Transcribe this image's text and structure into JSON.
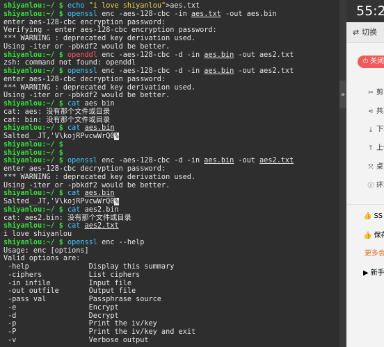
{
  "terminal": {
    "lines": [
      [
        {
          "t": "shiyanlou:~/ $ ",
          "k": "u"
        },
        {
          "t": "echo ",
          "k": "c"
        },
        {
          "t": "\"i love shiyanlou\"",
          "k": "s"
        },
        {
          "t": ">aes.txt",
          "k": "p"
        }
      ],
      [
        {
          "t": "shiyanlou:~/ $ ",
          "k": "u"
        },
        {
          "t": "openssl",
          "k": "c"
        },
        {
          "t": " enc -aes-128-cbc -in ",
          "k": "p"
        },
        {
          "t": "aes.txt",
          "k": "pu"
        },
        {
          "t": " -out aes.bin",
          "k": "p"
        }
      ],
      [
        {
          "t": "enter aes-128-cbc encryption password:",
          "k": "p"
        }
      ],
      [
        {
          "t": "Verifying - enter aes-128-cbc encryption password:",
          "k": "p"
        }
      ],
      [
        {
          "t": "*** WARNING : deprecated key derivation used.",
          "k": "p"
        }
      ],
      [
        {
          "t": "Using -iter or -pbkdf2 would be better.",
          "k": "p"
        }
      ],
      [
        {
          "t": "shiyanlou:~/ $ ",
          "k": "u"
        },
        {
          "t": "openddl",
          "k": "bad"
        },
        {
          "t": " enc -aes-128-cbc -d -in ",
          "k": "p"
        },
        {
          "t": "aes.bin",
          "k": "pu"
        },
        {
          "t": " -out aes2.txt",
          "k": "p"
        }
      ],
      [
        {
          "t": "zsh: command not found: openddl",
          "k": "p"
        }
      ],
      [
        {
          "t": "shiyanlou:~/ $ ",
          "k": "u"
        },
        {
          "t": "openssl",
          "k": "c"
        },
        {
          "t": " enc -aes-128-cbc -d -in ",
          "k": "p"
        },
        {
          "t": "aes.bin",
          "k": "pu"
        },
        {
          "t": " -out aes2.txt",
          "k": "p"
        }
      ],
      [
        {
          "t": "enter aes-128-cbc decryption password:",
          "k": "p"
        }
      ],
      [
        {
          "t": "*** WARNING : deprecated key derivation used.",
          "k": "p"
        }
      ],
      [
        {
          "t": "Using -iter or -pbkdf2 would be better.",
          "k": "p"
        }
      ],
      [
        {
          "t": "shiyanlou:~/ $ ",
          "k": "u"
        },
        {
          "t": "cat",
          "k": "c"
        },
        {
          "t": " aes bin",
          "k": "p"
        }
      ],
      [
        {
          "t": "cat: aes: 没有那个文件或目录",
          "k": "p"
        }
      ],
      [
        {
          "t": "cat: bin: 没有那个文件或目录",
          "k": "p"
        }
      ],
      [
        {
          "t": "shiyanlou:~/ $ ",
          "k": "u"
        },
        {
          "t": "cat ",
          "k": "c"
        },
        {
          "t": "aes.bin",
          "k": "pu"
        }
      ],
      [
        {
          "t": "Salted__JT,'V\\kojRPvcwWrQ0",
          "k": "p"
        },
        {
          "t": "%",
          "k": "cur"
        }
      ],
      [
        {
          "t": "shiyanlou:~/ $",
          "k": "u"
        }
      ],
      [
        {
          "t": "shiyanlou:~/ $",
          "k": "u"
        }
      ],
      [
        {
          "t": "shiyanlou:~/ $ ",
          "k": "u"
        },
        {
          "t": "openssl",
          "k": "c"
        },
        {
          "t": " enc -aes-128-cbc -d -in ",
          "k": "p"
        },
        {
          "t": "aes.bin",
          "k": "pu"
        },
        {
          "t": " -out ",
          "k": "p"
        },
        {
          "t": "aes2.txt",
          "k": "pu"
        }
      ],
      [
        {
          "t": "enter aes-128-cbc decryption password:",
          "k": "p"
        }
      ],
      [
        {
          "t": "*** WARNING : deprecated key derivation used.",
          "k": "p"
        }
      ],
      [
        {
          "t": "Using -iter or -pbkdf2 would be better.",
          "k": "p"
        }
      ],
      [
        {
          "t": "shiyanlou:~/ $ ",
          "k": "u"
        },
        {
          "t": "cat ",
          "k": "c"
        },
        {
          "t": "aes.bin",
          "k": "pu"
        }
      ],
      [
        {
          "t": "Salted__JT,'V\\kojRPvcwWrQ0",
          "k": "p"
        },
        {
          "t": "%",
          "k": "cur"
        }
      ],
      [
        {
          "t": "shiyanlou:~/ $ ",
          "k": "u"
        },
        {
          "t": "cat ",
          "k": "c"
        },
        {
          "t": "aes2.bin",
          "k": "p"
        }
      ],
      [
        {
          "t": "cat: aes2.bin: 没有那个文件或目录",
          "k": "p"
        }
      ],
      [
        {
          "t": "shiyanlou:~/ $ ",
          "k": "u"
        },
        {
          "t": "cat ",
          "k": "c"
        },
        {
          "t": "aes2.txt",
          "k": "pu"
        }
      ],
      [
        {
          "t": "i love shiyanlou",
          "k": "p"
        }
      ],
      [
        {
          "t": "shiyanlou:~/ $ ",
          "k": "u"
        },
        {
          "t": "openssl",
          "k": "c"
        },
        {
          "t": " enc --help",
          "k": "p"
        }
      ],
      [
        {
          "t": "Usage: enc [options]",
          "k": "p"
        }
      ],
      [
        {
          "t": "Valid options are:",
          "k": "p"
        }
      ],
      [
        {
          "t": " -help              Display this summary",
          "k": "p"
        }
      ],
      [
        {
          "t": " -ciphers           List ciphers",
          "k": "p"
        }
      ],
      [
        {
          "t": " -in infile         Input file",
          "k": "p"
        }
      ],
      [
        {
          "t": " -out outfile       Output file",
          "k": "p"
        }
      ],
      [
        {
          "t": " -pass val          Passphrase source",
          "k": "p"
        }
      ],
      [
        {
          "t": " -e                 Encrypt",
          "k": "p"
        }
      ],
      [
        {
          "t": " -d                 Decrypt",
          "k": "p"
        }
      ],
      [
        {
          "t": " -p                 Print the iv/key",
          "k": "p"
        }
      ],
      [
        {
          "t": " -P                 Print the iv/key and exit",
          "k": "p"
        }
      ],
      [
        {
          "t": " -v                 Verbose output",
          "k": "p"
        }
      ]
    ]
  },
  "panel": {
    "collapse_glyph": "»",
    "timer": "55:2",
    "switch_label": "切换",
    "switch_icon": "⇄",
    "off_label": "关闭",
    "off_icon": "⏻",
    "tools": [
      {
        "name": "scissors-icon",
        "icon": "✂",
        "label": "剪"
      },
      {
        "name": "share-icon",
        "icon": "⋖",
        "label": "共享"
      },
      {
        "name": "download-icon",
        "icon": "⤓",
        "label": "下载"
      },
      {
        "name": "upload-icon",
        "icon": "⤒",
        "label": "上传"
      },
      {
        "name": "desktop-icon",
        "icon": "⤧",
        "label": "桌面"
      },
      {
        "name": "info-icon",
        "icon": "ⓘ",
        "label": "环境"
      }
    ],
    "links": [
      {
        "name": "ssh-link",
        "icon": "👍",
        "label": "SS"
      },
      {
        "name": "save-link",
        "icon": "👍",
        "label": "保存"
      }
    ],
    "more_label": "更多会",
    "new_label": "新手"
  }
}
